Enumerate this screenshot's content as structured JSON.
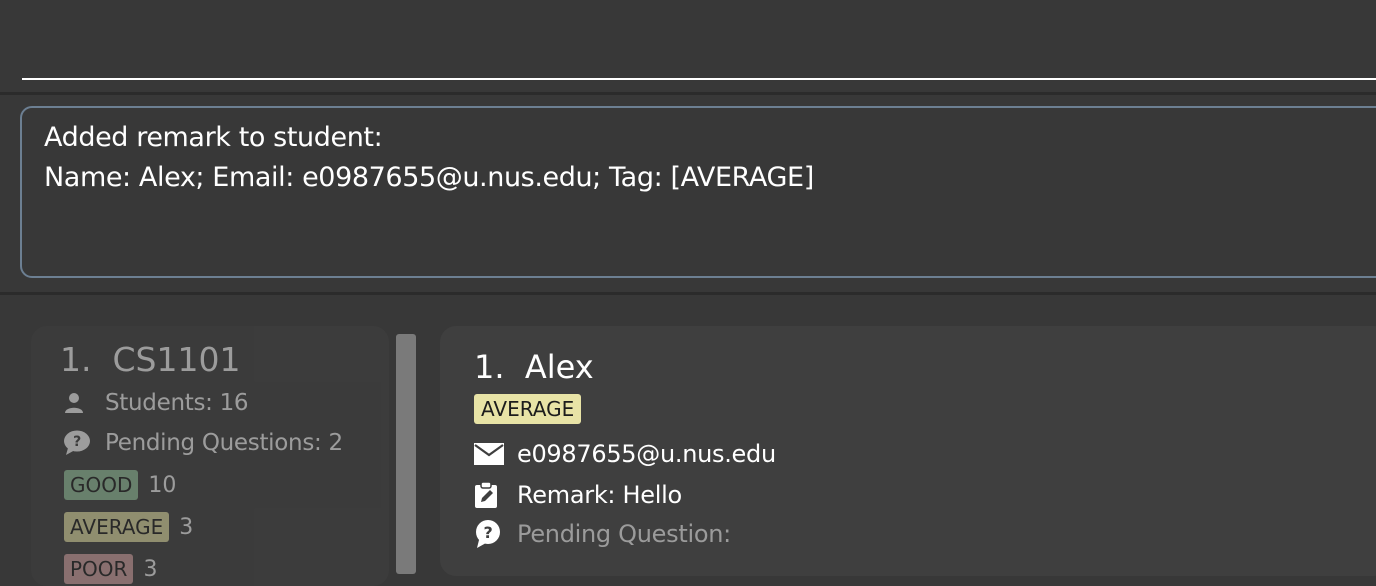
{
  "command_box": {
    "value": "",
    "placeholder": ""
  },
  "result_display": {
    "lines": [
      "Added remark to student:",
      "Name: Alex; Email: e0987655@u.nus.edu; Tag: [AVERAGE]"
    ]
  },
  "class_list": {
    "items": [
      {
        "index": "1.",
        "name": "CS1101",
        "students_label": "Students: 16",
        "pending_label": "Pending Questions: 2",
        "tags": [
          {
            "label": "GOOD",
            "count": "10"
          },
          {
            "label": "AVERAGE",
            "count": "3"
          },
          {
            "label": "POOR",
            "count": "3"
          }
        ]
      }
    ]
  },
  "student_list": {
    "items": [
      {
        "index": "1.",
        "name": "Alex",
        "tag": "AVERAGE",
        "email": "e0987655@u.nus.edu",
        "remark": "Remark: Hello",
        "pending_question": "Pending Question:"
      }
    ]
  },
  "colors": {
    "background": "#383838",
    "card": "#3f3f3f",
    "result_border": "#6c7f92",
    "tag_good": "#98c8a0",
    "tag_average": "#e8e3a6",
    "tag_poor": "#d9a7a7"
  },
  "icons": {
    "students": "person-icon",
    "pending_questions": "speech-bubble-question-icon",
    "email": "envelope-icon",
    "remark": "clipboard-edit-icon",
    "pending_question": "question-bubble-icon"
  }
}
